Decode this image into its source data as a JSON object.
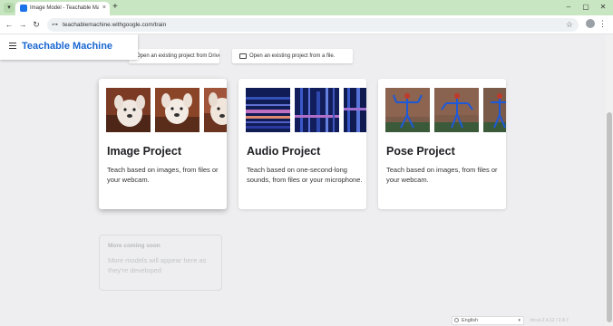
{
  "browser": {
    "tab_title": "Image Model - Teachable Machine",
    "tab_list_icon": "chevron-down-icon",
    "close_glyph": "×",
    "new_tab_glyph": "+",
    "minimize_glyph": "–",
    "maximize_glyph": "▢",
    "close_window_glyph": "✕",
    "back_glyph": "←",
    "forward_glyph": "→",
    "reload_glyph": "↻",
    "site_info_glyph": "⊶",
    "url": "teachablemachine.withgoogle.com/train",
    "star_glyph": "☆",
    "menu_glyph": "⋮",
    "tab_bar_color": "#c8e6c1"
  },
  "header": {
    "brand": "Teachable Machine",
    "brand_color": "#1967d2"
  },
  "actions": {
    "drive_label": "Open an existing project from Drive.",
    "file_label": "Open an existing project from a file."
  },
  "cards": [
    {
      "title": "Image Project",
      "desc": "Teach based on images, from files or your webcam.",
      "thumb_kind": "dog"
    },
    {
      "title": "Audio Project",
      "desc": "Teach based on one-second-long sounds, from files or your microphone.",
      "thumb_kind": "spectrogram"
    },
    {
      "title": "Pose Project",
      "desc": "Teach based on images, from files or your webcam.",
      "thumb_kind": "pose"
    }
  ],
  "coming_soon": {
    "title": "More coming soon",
    "desc": "More models will appear here as they're developed"
  },
  "footer": {
    "language": "English",
    "version": "tm-ui-2.4.12 / 2.4.7"
  }
}
